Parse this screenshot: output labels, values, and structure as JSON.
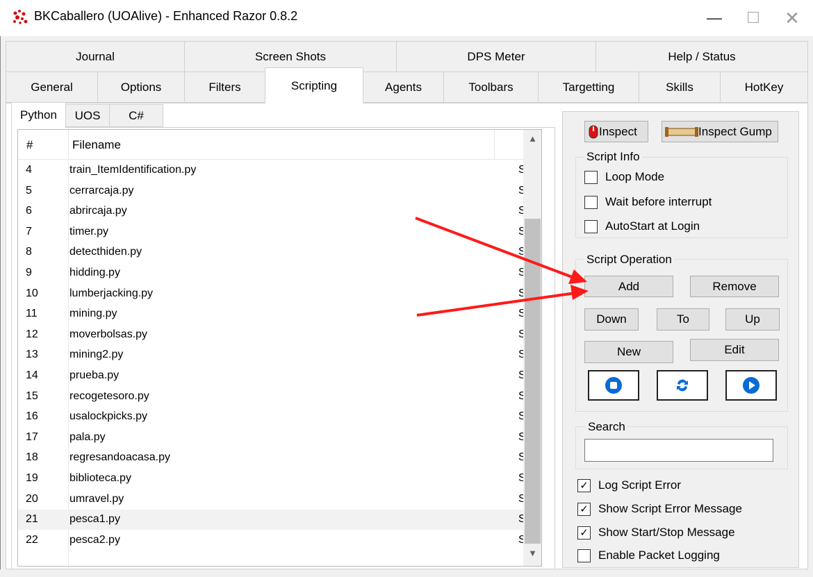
{
  "window": {
    "title": "BKCaballero (UOAlive) - Enhanced Razor 0.8.2",
    "min_symbol": "—",
    "max_symbol": "☐",
    "close_symbol": "✕"
  },
  "tabs_row1": [
    "Journal",
    "Screen Shots",
    "DPS Meter",
    "Help / Status"
  ],
  "tabs_row2": [
    "General",
    "Options",
    "Filters",
    "Scripting",
    "Agents",
    "Toolbars",
    "Targetting",
    "Skills",
    "HotKey"
  ],
  "active_tab": "Scripting",
  "subtabs": [
    "Python",
    "UOS",
    "C#"
  ],
  "active_subtab": "Python",
  "list": {
    "headers": {
      "num": "#",
      "filename": "Filename"
    },
    "rows": [
      {
        "num": "4",
        "filename": "train_ItemIdentification.py",
        "status": "S"
      },
      {
        "num": "5",
        "filename": "cerrarcaja.py",
        "status": "S"
      },
      {
        "num": "6",
        "filename": "abrircaja.py",
        "status": "S"
      },
      {
        "num": "7",
        "filename": "timer.py",
        "status": "S"
      },
      {
        "num": "8",
        "filename": "detecthiden.py",
        "status": "S"
      },
      {
        "num": "9",
        "filename": "hidding.py",
        "status": "S"
      },
      {
        "num": "10",
        "filename": "lumberjacking.py",
        "status": "S"
      },
      {
        "num": "11",
        "filename": "mining.py",
        "status": "S"
      },
      {
        "num": "12",
        "filename": "moverbolsas.py",
        "status": "S"
      },
      {
        "num": "13",
        "filename": "mining2.py",
        "status": "S"
      },
      {
        "num": "14",
        "filename": "prueba.py",
        "status": "S"
      },
      {
        "num": "15",
        "filename": "recogetesoro.py",
        "status": "S"
      },
      {
        "num": "16",
        "filename": "usalockpicks.py",
        "status": "S"
      },
      {
        "num": "17",
        "filename": "pala.py",
        "status": "S"
      },
      {
        "num": "18",
        "filename": "regresandoacasa.py",
        "status": "S"
      },
      {
        "num": "19",
        "filename": "biblioteca.py",
        "status": "S"
      },
      {
        "num": "20",
        "filename": "umravel.py",
        "status": "S"
      },
      {
        "num": "21",
        "filename": "pesca1.py",
        "status": "S",
        "selected": true
      },
      {
        "num": "22",
        "filename": "pesca2.py",
        "status": "S"
      }
    ]
  },
  "inspect": {
    "inspect_label": "Inspect",
    "inspect_gump_label": "Inspect Gump"
  },
  "script_info": {
    "title": "Script Info",
    "loop_mode": {
      "label": "Loop Mode",
      "checked": false
    },
    "wait_before_interrupt": {
      "label": "Wait before interrupt",
      "checked": false
    },
    "autostart": {
      "label": "AutoStart at Login",
      "checked": false
    }
  },
  "script_operation": {
    "title": "Script Operation",
    "add": "Add",
    "remove": "Remove",
    "down": "Down",
    "to": "To",
    "up": "Up",
    "new": "New",
    "edit": "Edit"
  },
  "search": {
    "title": "Search",
    "value": ""
  },
  "options": {
    "log_script_error": {
      "label": "Log Script Error",
      "checked": true
    },
    "show_script_error_message": {
      "label": "Show Script Error Message",
      "checked": true
    },
    "show_start_stop_message": {
      "label": "Show Start/Stop Message",
      "checked": true
    },
    "enable_packet_logging": {
      "label": "Enable Packet Logging",
      "checked": false
    }
  },
  "colors": {
    "annotation_arrow": "#ff1a1a",
    "icon_blue": "#0a6bd6"
  },
  "check_mark": "✓"
}
